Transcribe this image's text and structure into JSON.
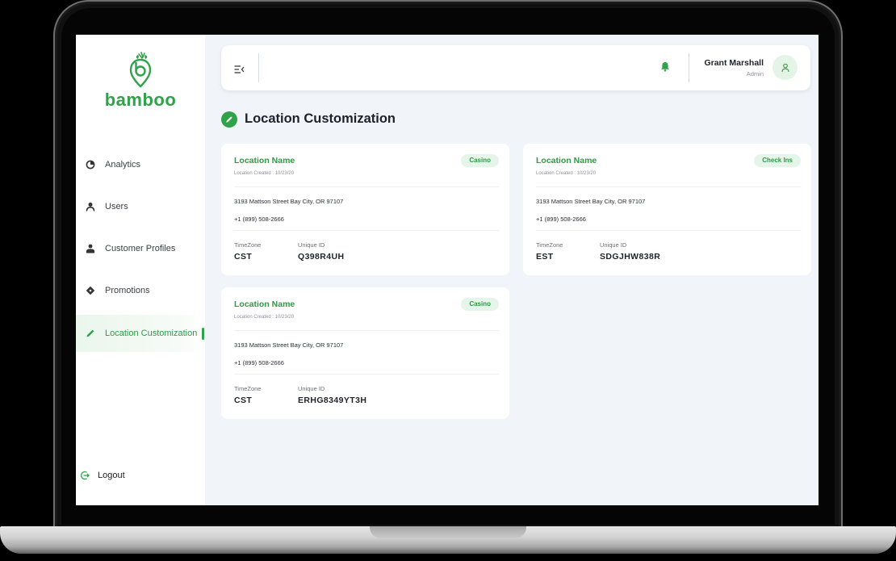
{
  "brand": {
    "name": "bamboo",
    "tagline": "",
    "accent": "#2fa24a"
  },
  "sidebar": {
    "items": [
      {
        "label": "Analytics",
        "icon": "pie-chart-icon"
      },
      {
        "label": "Users",
        "icon": "user-icon"
      },
      {
        "label": "Customer Profiles",
        "icon": "profiles-icon"
      },
      {
        "label": "Promotions",
        "icon": "tag-icon"
      },
      {
        "label": "Location Customization",
        "icon": "pencil-icon",
        "active": true
      }
    ],
    "logout": "Logout"
  },
  "header": {
    "user_name": "Grant Marshall",
    "user_role": "Admin"
  },
  "page": {
    "title": "Location Customization"
  },
  "cards": [
    {
      "name": "Location Name",
      "created": "Location Created : 10/23/20",
      "badge": "Casino",
      "address": "3193 Mattson Street Bay City, OR 97107",
      "phone": "+1 (899) 508-2666",
      "timezone_label": "TimeZone",
      "timezone": "CST",
      "uid_label": "Unique ID",
      "uid": "Q398R4UH"
    },
    {
      "name": "Location Name",
      "created": "Location Created : 10/23/20",
      "badge": "Check Ins",
      "address": "3193 Mattson Street Bay City, OR 97107",
      "phone": "+1 (899) 508-2666",
      "timezone_label": "TimeZone",
      "timezone": "EST",
      "uid_label": "Unique ID",
      "uid": "SDGJHW838R"
    },
    {
      "name": "Location Name",
      "created": "Location Created : 10/23/20",
      "badge": "Casino",
      "address": "3193 Mattson Street Bay City, OR 97107",
      "phone": "+1 (899) 508-2666",
      "timezone_label": "TimeZone",
      "timezone": "CST",
      "uid_label": "Unique ID",
      "uid": "ERHG8349YT3H"
    }
  ]
}
